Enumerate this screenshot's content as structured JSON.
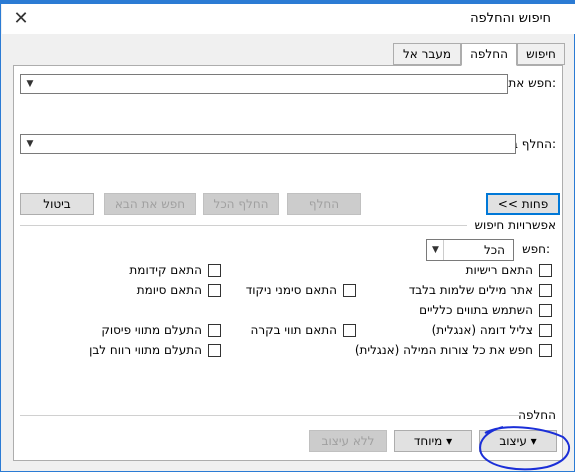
{
  "window": {
    "title": "חיפוש והחלפה",
    "close_glyph": "✕"
  },
  "tabs": [
    {
      "label": "חיפוש"
    },
    {
      "label": "החלפה"
    },
    {
      "label": "מעבר אל"
    }
  ],
  "find": {
    "label": "חפש את:",
    "value": ""
  },
  "replace": {
    "label": "החלף ב:",
    "value": ""
  },
  "buttons": {
    "less": "<< פחות",
    "replace": "החלף",
    "replace_all": "החלף הכל",
    "find_next": "חפש את הבא",
    "cancel": "ביטול"
  },
  "options": {
    "section_title": "אפשרויות חיפוש",
    "search_label": "חפש:",
    "search_value": "הכל",
    "checkboxes_right": [
      "התאם רישיות",
      "אתר מילים שלמות בלבד",
      "השתמש בתווים כלליים",
      "צליל דומה (אנגלית)",
      "חפש את כל צורות המילה (אנגלית)"
    ],
    "checkboxes_middle": [
      "התאם סימני ניקוד",
      "התאם תווי בקרה"
    ],
    "checkboxes_left": [
      "התאם קידומת",
      "התאם סיומת",
      "התעלם מתווי פיסוק",
      "התעלם מתווי רווח לבן"
    ]
  },
  "replace_section": {
    "title": "החלפה",
    "format_button": "עיצוב ▾",
    "special_button": "מיוחד ▾",
    "no_formatting_button": "ללא עיצוב"
  },
  "colors": {
    "accent": "#0078d7",
    "annotation": "#1b2fd8"
  }
}
